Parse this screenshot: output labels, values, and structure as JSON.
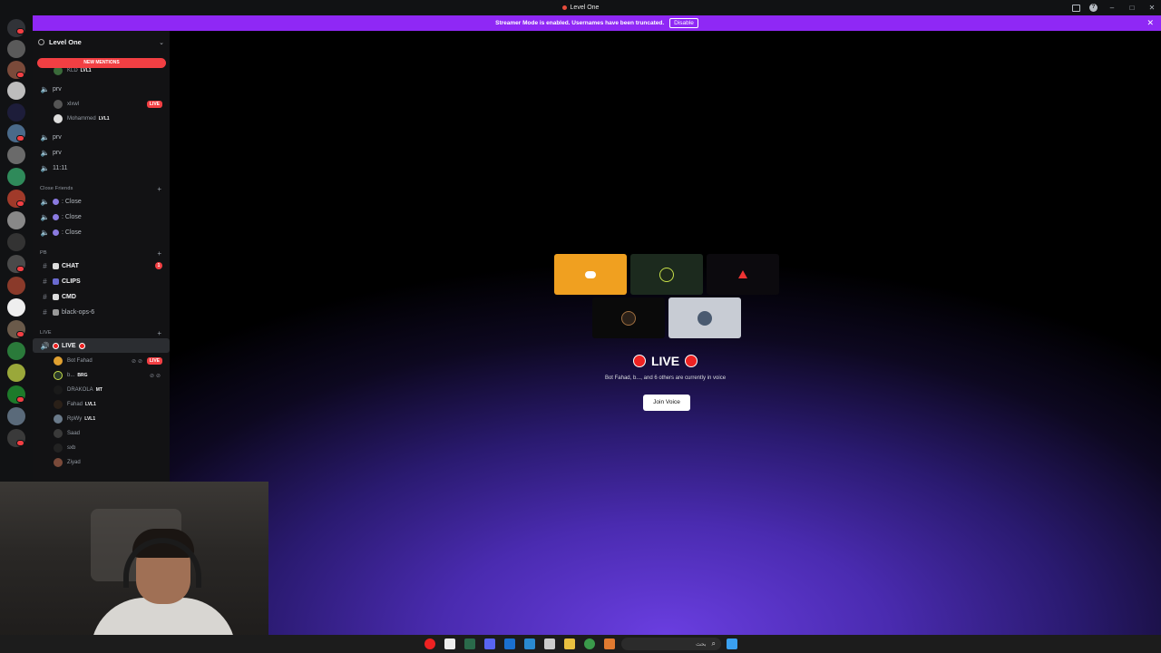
{
  "window": {
    "title": "Level One"
  },
  "banner": {
    "message": "Streamer Mode is enabled. Usernames have been truncated.",
    "disable_label": "Disable"
  },
  "server": {
    "name": "Level One",
    "new_mentions_label": "NEW MENTIONS"
  },
  "sidebar": {
    "top_users": [
      {
        "name": "KLD",
        "tag": "LVL1"
      }
    ],
    "channel_prv1": {
      "label": "prv"
    },
    "prv1_users": [
      {
        "name": "xlxwl",
        "live": "LIVE"
      },
      {
        "name": "Mohammed",
        "tag": "LVL1"
      }
    ],
    "channel_prv2": {
      "label": "prv"
    },
    "channel_prv3": {
      "label": "prv"
    },
    "channel_1111": {
      "label": "11:11"
    },
    "cat_close": {
      "label": "Close Friends"
    },
    "close_channels": [
      {
        "label": ": Close"
      },
      {
        "label": ": Close"
      },
      {
        "label": ": Close"
      }
    ],
    "cat_pb": {
      "label": "PB"
    },
    "text_channels": [
      {
        "label": "CHAT",
        "unread": "1"
      },
      {
        "label": "CLIPS"
      },
      {
        "label": "CMD"
      },
      {
        "label": "black-ops-6"
      }
    ],
    "cat_live": {
      "label": "LIVE"
    },
    "live_channel": {
      "label": "LIVE"
    },
    "live_users": [
      {
        "name": "Bot Fahad",
        "live": "LIVE"
      },
      {
        "name": "b...",
        "tag": "BRG"
      },
      {
        "name": "DRAKOLA",
        "tag": "MT"
      },
      {
        "name": "Fahad",
        "tag": "LVL1"
      },
      {
        "name": "RpWy",
        "tag": "LVL1"
      },
      {
        "name": "Saad"
      },
      {
        "name": "sxb"
      },
      {
        "name": "Ziyad"
      }
    ]
  },
  "stage": {
    "channel_title": "LIVE",
    "voice_status": "Bot Fahad, b..., and 6 others are currently in voice",
    "join_label": "Join Voice"
  },
  "taskbar": {
    "search_placeholder": "بحث"
  },
  "colors": {
    "brand": "#8f28f5",
    "live_red": "#f23f43",
    "stage_purple": "#6a3ee0"
  }
}
